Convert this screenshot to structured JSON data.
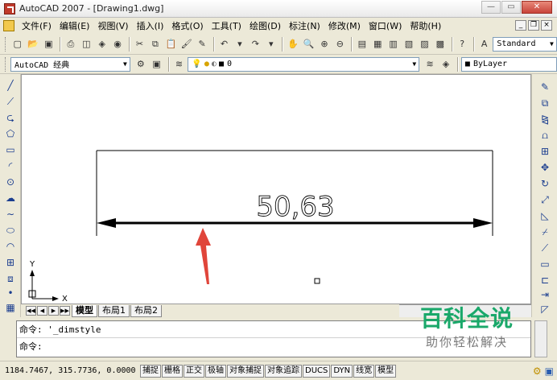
{
  "window": {
    "title": "AutoCAD 2007 - [Drawing1.dwg]"
  },
  "menu": {
    "items": [
      "文件(F)",
      "编辑(E)",
      "视图(V)",
      "插入(I)",
      "格式(O)",
      "工具(T)",
      "绘图(D)",
      "标注(N)",
      "修改(M)",
      "窗口(W)",
      "帮助(H)"
    ]
  },
  "toolbar": {
    "text_style": "Standard",
    "workspace": "AutoCAD 经典",
    "layer": "0",
    "color": "ByLayer"
  },
  "drawing": {
    "dimension_text": "50,63",
    "ucs_y": "Y",
    "ucs_x": "X"
  },
  "layout_tabs": [
    "模型",
    "布局1",
    "布局2"
  ],
  "command": {
    "history": "命令: '_dimstyle",
    "prompt": "命令:"
  },
  "status": {
    "coords": "1184.7467, 315.7736, 0.0000",
    "buttons": [
      "捕捉",
      "栅格",
      "正交",
      "极轴",
      "对象捕捉",
      "对象追踪",
      "DUCS",
      "DYN",
      "线宽",
      "模型"
    ]
  },
  "watermark": {
    "line1": "百科全说",
    "line2": "助你轻松解决"
  },
  "colors": {
    "arrow": "#e0453a",
    "watermark_green": "#1aa86a"
  }
}
